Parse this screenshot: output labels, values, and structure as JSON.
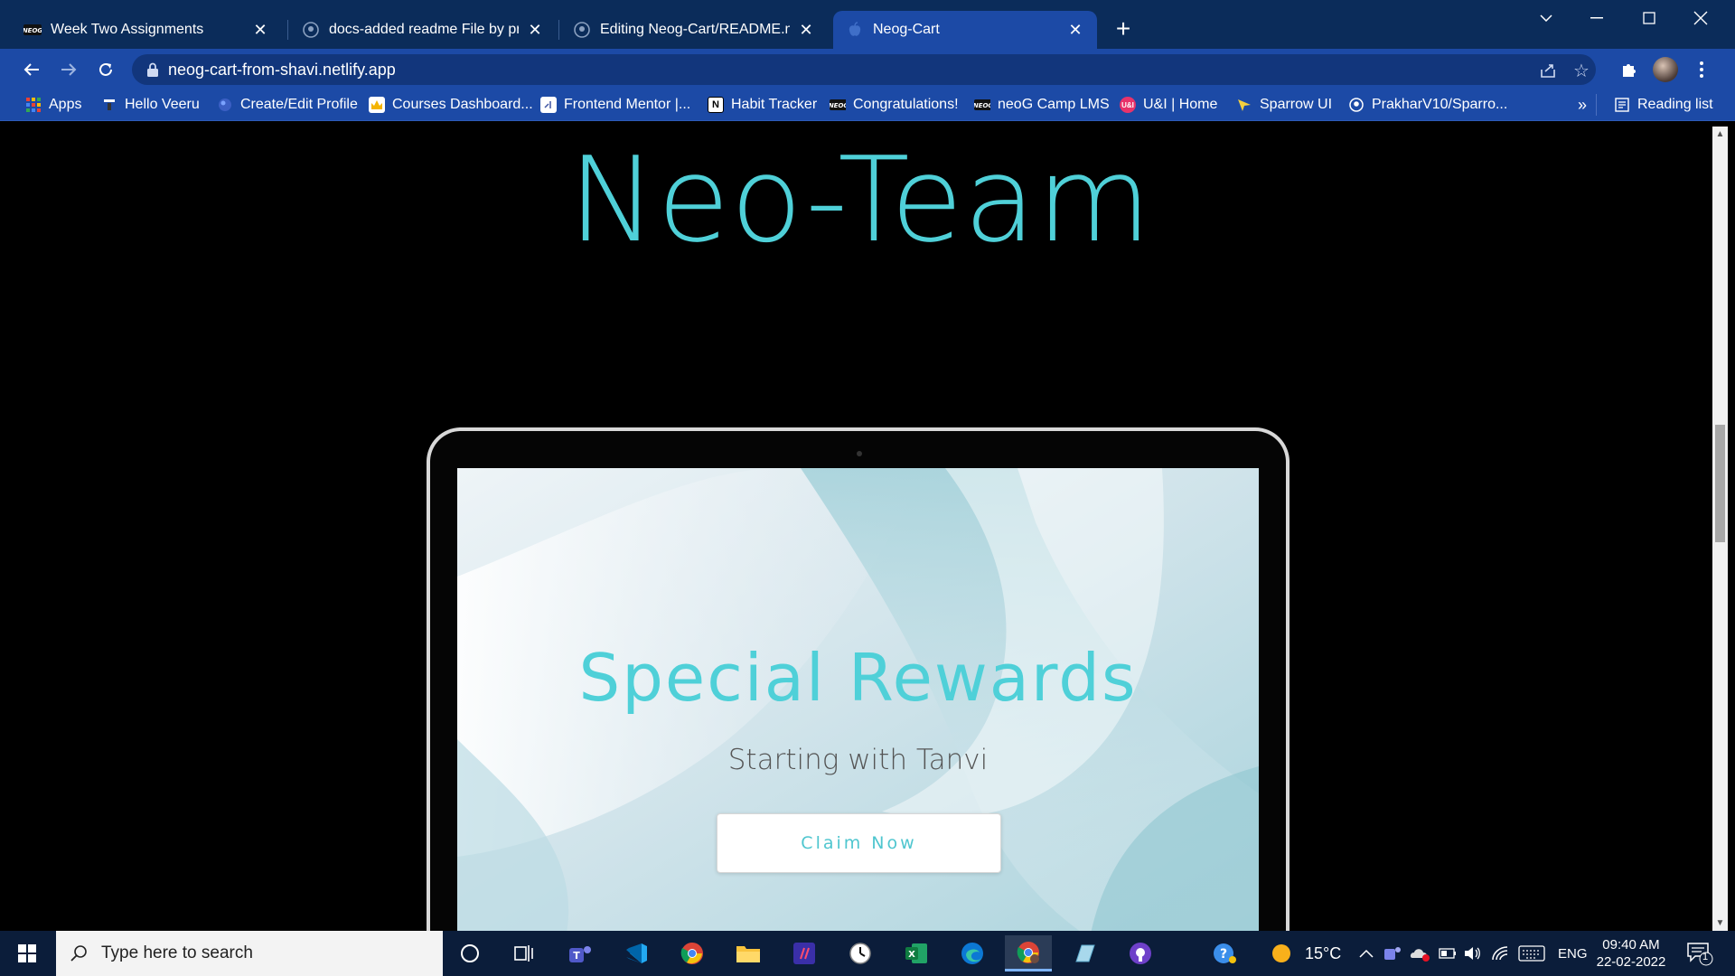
{
  "browser": {
    "tabs": [
      {
        "title": "Week Two Assignments",
        "favicon": "neog-logo-icon",
        "active": false
      },
      {
        "title": "docs-added readme File by prath",
        "favicon": "github-icon",
        "active": false
      },
      {
        "title": "Editing Neog-Cart/README.md a",
        "favicon": "github-icon",
        "active": false
      },
      {
        "title": "Neog-Cart",
        "favicon": "apple-icon",
        "active": true
      }
    ],
    "new_tab_glyph": "+",
    "url": "neog-cart-from-shavi.netlify.app",
    "bookmarks": [
      {
        "label": "Apps",
        "icon": "apps-grid-icon"
      },
      {
        "label": "Hello Veeru",
        "icon": "page-icon"
      },
      {
        "label": "Create/Edit Profile",
        "icon": "globe-icon"
      },
      {
        "label": "Courses Dashboard...",
        "icon": "crown-icon"
      },
      {
        "label": "Frontend Mentor |...",
        "icon": "frontend-mentor-icon"
      },
      {
        "label": "Habit Tracker",
        "icon": "notion-icon"
      },
      {
        "label": "Congratulations!",
        "icon": "neog-logo-icon"
      },
      {
        "label": "neoG Camp LMS",
        "icon": "neog-logo-icon"
      },
      {
        "label": "U&I | Home",
        "icon": "ui-logo-icon"
      },
      {
        "label": "Sparrow UI",
        "icon": "sparrow-icon"
      },
      {
        "label": "PrakharV10/Sparro...",
        "icon": "github-icon"
      }
    ],
    "overflow_glyph": "»",
    "reading_list": "Reading list"
  },
  "page": {
    "team_title": "Neo-Team",
    "hero": {
      "title": "Special Rewards",
      "subtitle": "Starting with Tanvi",
      "cta": "Claim Now"
    }
  },
  "taskbar": {
    "search_placeholder": "Type here to search",
    "weather": "15°C",
    "language": "ENG",
    "time": "09:40 AM",
    "date": "22-02-2022",
    "notification_count": "1"
  },
  "colors": {
    "accent_teal": "#4fd0d8",
    "chrome_blue": "#1c4aa6",
    "tabstrip": "#0b2c5a",
    "taskbar": "#0b1d3a"
  }
}
